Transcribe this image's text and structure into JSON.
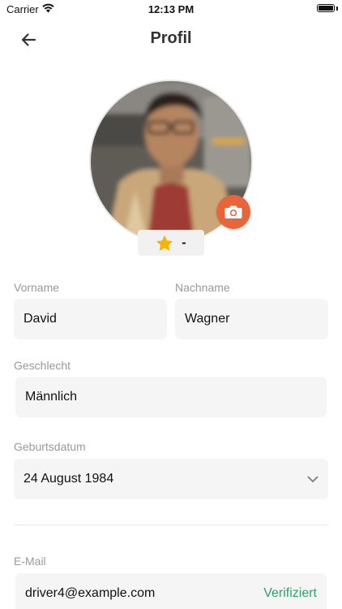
{
  "status_bar": {
    "carrier": "Carrier",
    "time": "12:13 PM"
  },
  "header": {
    "title": "Profil",
    "back_icon": "arrow-left-icon"
  },
  "profile": {
    "rating_value": "-",
    "rating_icon": "star-icon",
    "camera_icon": "camera-icon"
  },
  "form": {
    "first_name": {
      "label": "Vorname",
      "value": "David"
    },
    "last_name": {
      "label": "Nachname",
      "value": "Wagner"
    },
    "gender": {
      "label": "Geschlecht",
      "value": "Männlich"
    },
    "birthdate": {
      "label": "Geburtsdatum",
      "value": "24 August 1984"
    },
    "email": {
      "label": "E-Mail",
      "value": "driver4@example.com",
      "status": "Verifiziert"
    }
  },
  "colors": {
    "accent": "#e8643a",
    "star": "#f5b400",
    "verified": "#2aa36b",
    "field_bg": "#f5f5f5",
    "label": "#999999"
  }
}
